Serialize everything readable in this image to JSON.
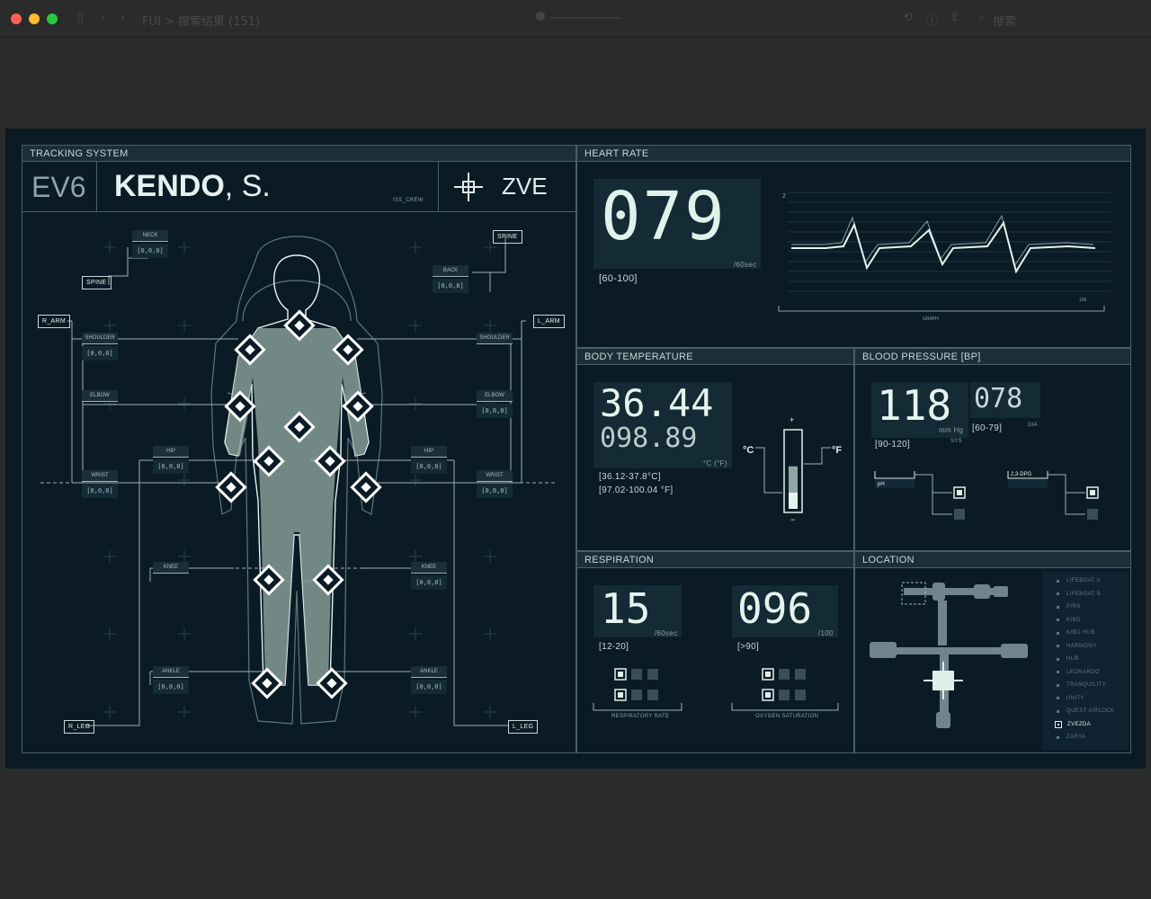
{
  "window": {
    "title": "FUI > 搜索结果 (151)",
    "search_label": "搜索",
    "colors": {
      "close": "#fe5f57",
      "min": "#febc2e",
      "max": "#28c840"
    }
  },
  "colors": {
    "bg": "#0a1b25",
    "panel_border": "#48606a",
    "header": "#1b2f38",
    "text": "#dfeeed",
    "dim": "#8aa0a6"
  },
  "tracking": {
    "header": "TRACKING SYSTEM",
    "crew_code": "EV6",
    "name_last": "KENDO",
    "name_sep": ", ",
    "name_first": "S.",
    "crew_tag": "ISS_CREW",
    "module": "ZVE",
    "joints_left": [
      {
        "label": "NECK",
        "value": "[0,0,0]"
      },
      {
        "label": "SHOULDER",
        "value": "[0,0,0]"
      },
      {
        "label": "ELBOW",
        "value": ""
      },
      {
        "label": "HIP",
        "value": "[0,0,0]"
      },
      {
        "label": "WRIST",
        "value": "[0,0,0]"
      },
      {
        "label": "KNEE",
        "value": ""
      },
      {
        "label": "ANKLE",
        "value": "[0,0,0]"
      }
    ],
    "joints_right": [
      {
        "label": "BACK",
        "value": "[0,0,0]"
      },
      {
        "label": "SHOULDER",
        "value": ""
      },
      {
        "label": "ELBOW",
        "value": "[0,0,0]"
      },
      {
        "label": "HIP",
        "value": "[0,0,0]"
      },
      {
        "label": "WRIST",
        "value": "[0,0,0]"
      },
      {
        "label": "KNEE",
        "value": "[0,0,0]"
      },
      {
        "label": "ANKLE",
        "value": "[0,0,0]"
      }
    ],
    "tags": {
      "spine_left": "SPINE",
      "spine_right": "SPINE",
      "r_arm": "R_ARM",
      "l_arm": "L_ARM",
      "r_leg": "R_LEG",
      "l_leg": "L_LEG"
    }
  },
  "heart": {
    "header": "HEART RATE",
    "value": "079",
    "unit": "/60sec",
    "range": "[60-100]",
    "axis_label": "GRAPH",
    "axis_max": "100",
    "axis_tick": "2"
  },
  "temp": {
    "header": "BODY TEMPERATURE",
    "celsius": "36.44",
    "fahrenheit": "098.89",
    "unit": "°C (°F)",
    "range_c": "[36.12-37.8°C]",
    "range_f": "[97.02-100.04 °F]",
    "c_label": "°C",
    "f_label": "°F",
    "plus": "+",
    "minus": "−",
    "level": 0.55
  },
  "bp": {
    "header": "BLOOD PRESSURE [BP]",
    "sys": "118",
    "dia": "078",
    "unit": "mm Hg",
    "sys_label": "SYS",
    "dia_label": "DIA",
    "sys_range": "[90-120]",
    "dia_range": "[60-79]",
    "ph_label": "pH",
    "dpg_label": "2,3-DPG"
  },
  "resp": {
    "header": "RESPIRATION",
    "rate": "15",
    "rate_unit": "/60sec",
    "rate_range": "[12-20]",
    "rate_label": "RESPIRATORY RATE",
    "sat": "096",
    "sat_unit": "/100",
    "sat_range": "[>90]",
    "sat_label": "OXYGEN SATURATION"
  },
  "location": {
    "header": "LOCATION",
    "modules": [
      "LIFEBOAT A",
      "LIFEBOAT B",
      "PIRS",
      "KIBO",
      "KIBO HUB",
      "HARMONY",
      "HUB",
      "LEONARDO",
      "TRANQUILITY",
      "UNITY",
      "QUEST AIRLOCK",
      "ZVEZDA",
      "ZARYA"
    ],
    "selected": "ZVEZDA"
  }
}
